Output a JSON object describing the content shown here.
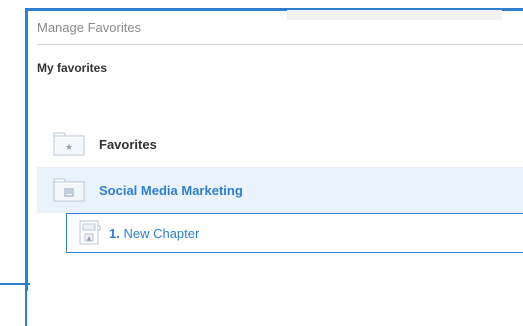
{
  "dialog": {
    "title": "Manage Favorites",
    "section_heading": "My favorites"
  },
  "favorites": {
    "items": [
      {
        "label": "Favorites",
        "icon": "star-folder-icon",
        "selected": false
      },
      {
        "label": "Social Media Marketing",
        "icon": "list-folder-icon",
        "selected": true
      }
    ],
    "chapter": {
      "number": "1.",
      "label": "New Chapter",
      "icon": "chapter-document-icon"
    }
  },
  "colors": {
    "accent": "#2f7fce",
    "selected_bg": "#eaf2fb",
    "text": "#333333",
    "muted": "#8a8a8a"
  }
}
